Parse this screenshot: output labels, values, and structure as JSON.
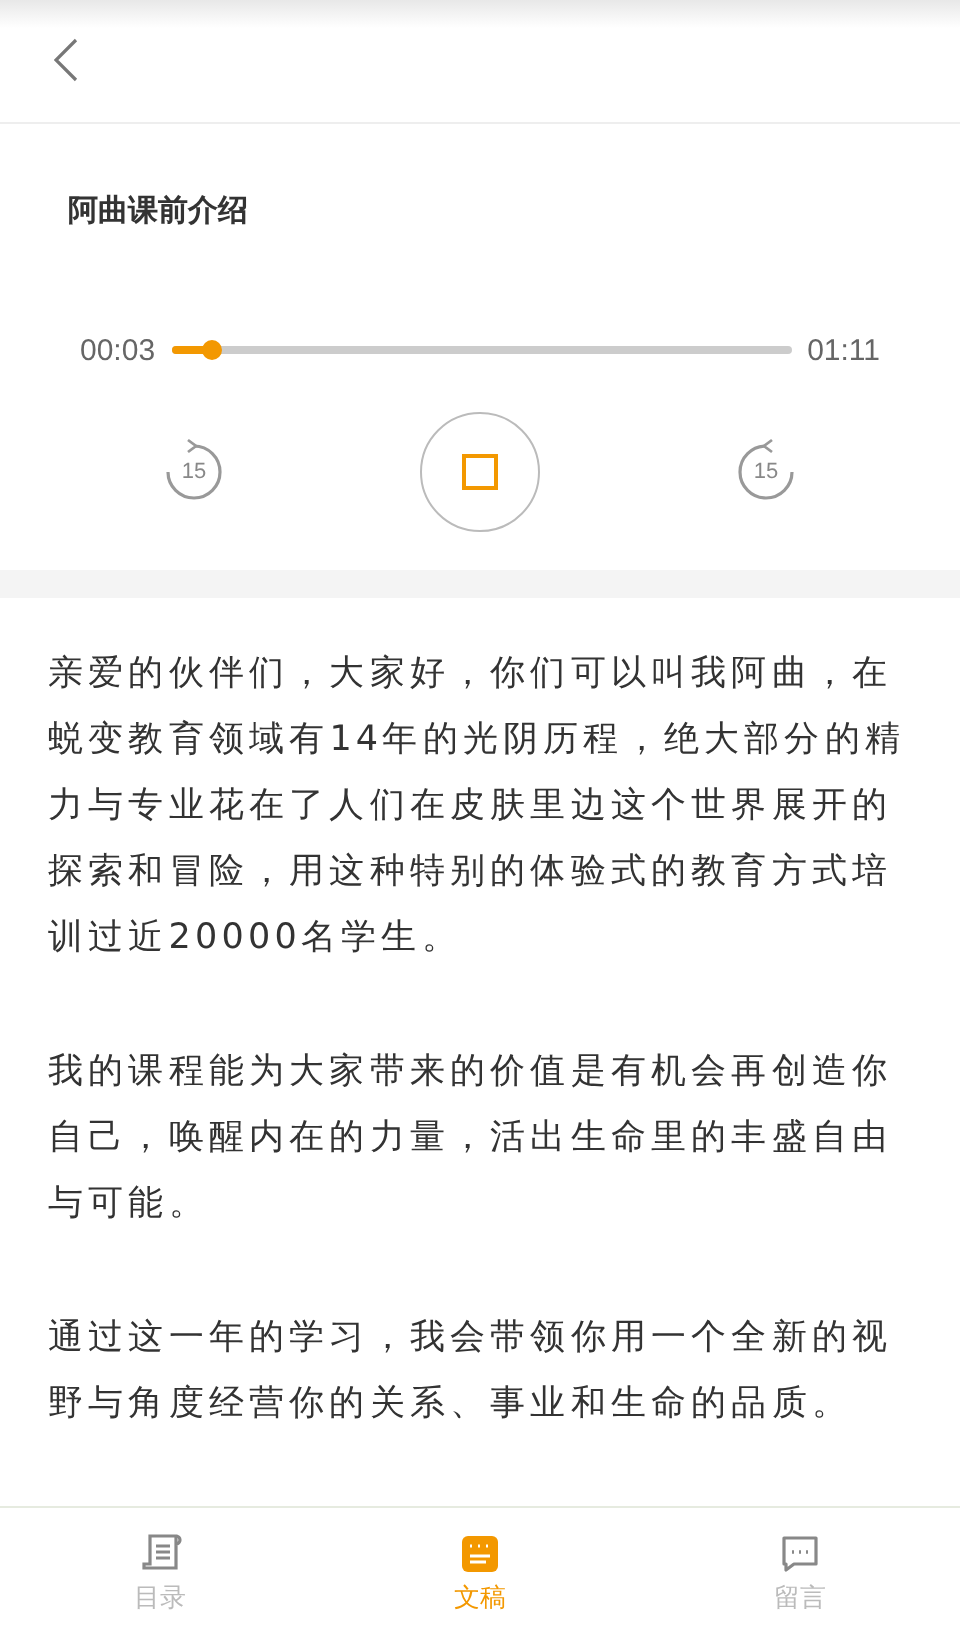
{
  "player": {
    "title": "阿曲课前介绍",
    "elapsed": "00:03",
    "duration": "01:11",
    "level": 0.066,
    "rewind_label": "15",
    "forward_label": "15",
    "playing": true
  },
  "paragraphs": [
    "亲爱的伙伴们，大家好，你们可以叫我阿曲，在蜕变教育领域有14年的光阴历程，绝大部分的精力与专业花在了人们在皮肤里边这个世界展开的探索和冒险，用这种特别的体验式的教育方式培训过近20000名学生。",
    "我的课程能为大家带来的价值是有机会再创造你自己，唤醒内在的力量，活出生命里的丰盛自由与可能。",
    "通过这一年的学习，我会带领你用一个全新的视野与角度经营你的关系、事业和生命的品质。"
  ],
  "tabs": [
    {
      "label": "目录",
      "kind": "catalog",
      "selected": false
    },
    {
      "label": "文稿",
      "kind": "transcript",
      "selected": true
    },
    {
      "label": "留言",
      "kind": "comments",
      "selected": false
    }
  ]
}
